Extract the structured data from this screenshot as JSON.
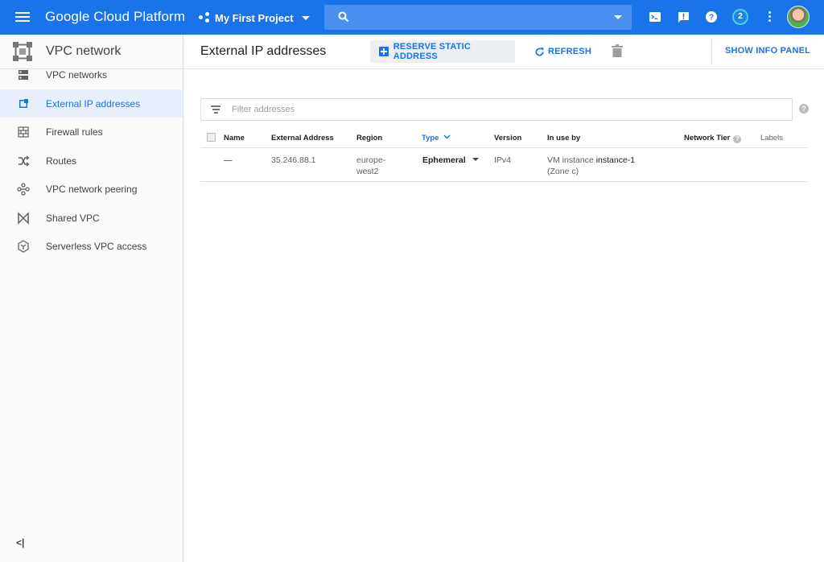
{
  "topbar": {
    "brand": "Google Cloud Platform",
    "project": "My First Project",
    "notification_count": "2"
  },
  "sidebar": {
    "title": "VPC network",
    "items": [
      {
        "label": "VPC networks",
        "icon": "vpc-networks-icon"
      },
      {
        "label": "External IP addresses",
        "icon": "external-ip-icon"
      },
      {
        "label": "Firewall rules",
        "icon": "firewall-icon"
      },
      {
        "label": "Routes",
        "icon": "routes-icon"
      },
      {
        "label": "VPC network peering",
        "icon": "peering-icon"
      },
      {
        "label": "Shared VPC",
        "icon": "shared-vpc-icon"
      },
      {
        "label": "Serverless VPC access",
        "icon": "serverless-icon"
      }
    ],
    "active_index": 1,
    "collapse_label": "<|"
  },
  "main": {
    "title": "External IP addresses",
    "reserve_label": "RESERVE STATIC ADDRESS",
    "refresh_label": "REFRESH",
    "info_label": "SHOW INFO PANEL",
    "filter_placeholder": "Filter addresses"
  },
  "table": {
    "headers": {
      "name": "Name",
      "external_address": "External Address",
      "region": "Region",
      "type": "Type",
      "version": "Version",
      "in_use_by": "In use by",
      "network_tier": "Network Tier",
      "labels": "Labels"
    },
    "rows": [
      {
        "name": "—",
        "external_address": "35.246.88.1",
        "region_line1": "europe-",
        "region_line2": "west2",
        "type": "Ephemeral",
        "version": "IPv4",
        "in_use_prefix": "VM instance ",
        "in_use_instance": "instance-1",
        "in_use_zone": "(Zone c)"
      }
    ]
  },
  "colors": {
    "accent": "#1a73e8",
    "topbar": "#1a73e8",
    "active_bg": "#e8f0fe"
  }
}
